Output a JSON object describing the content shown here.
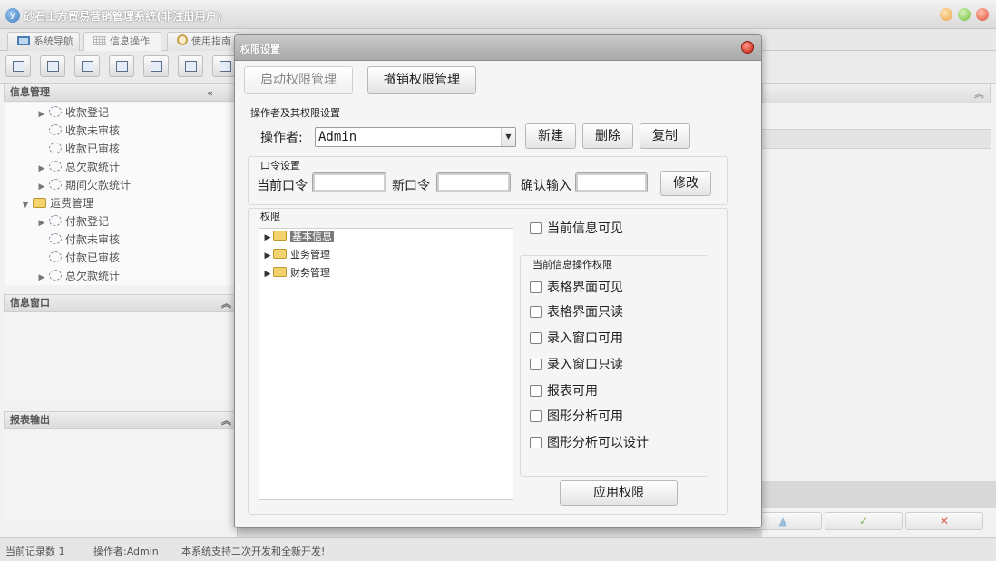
{
  "app": {
    "title": "砂石土方贸易营销管理系统(非注册用户)"
  },
  "tabs": [
    {
      "label": "系统导航"
    },
    {
      "label": "信息操作"
    },
    {
      "label": "使用指南"
    }
  ],
  "left_panel": {
    "info_mgmt_title": "信息管理",
    "collapse_icon": "«",
    "tree": [
      {
        "label": "收款登记",
        "arrow": "▶"
      },
      {
        "label": "收款未审核",
        "arrow": ""
      },
      {
        "label": "收款已审核",
        "arrow": ""
      },
      {
        "label": "总欠款统计",
        "arrow": "▶"
      },
      {
        "label": "期间欠款统计",
        "arrow": "▶"
      },
      {
        "label": "运费管理",
        "arrow": "▼"
      },
      {
        "label": "付款登记",
        "arrow": "▶"
      },
      {
        "label": "付款未审核",
        "arrow": ""
      },
      {
        "label": "付款已审核",
        "arrow": ""
      },
      {
        "label": "总欠款统计",
        "arrow": "▶"
      }
    ],
    "info_window_title": "信息窗口",
    "report_title": "报表输出"
  },
  "statusbar": {
    "record_count": "当前记录数 1",
    "operator": "操作者:Admin",
    "notice": "本系统支持二次开发和全新开发!"
  },
  "dialog": {
    "title": "权限设置",
    "enable_btn": "启动权限管理",
    "revoke_btn": "撤销权限管理",
    "operator_group_label": "操作者及其权限设置",
    "operator_label": "操作者:",
    "operator_value": "Admin",
    "new_btn": "新建",
    "delete_btn": "删除",
    "copy_btn": "复制",
    "password_group_label": "口令设置",
    "current_pwd_label": "当前口令",
    "new_pwd_label": "新口令",
    "confirm_label": "确认输入",
    "modify_btn": "修改",
    "permission_group_label": "权限",
    "perm_tree": [
      {
        "label": "基本信息",
        "selected": true
      },
      {
        "label": "业务管理",
        "selected": false
      },
      {
        "label": "财务管理",
        "selected": false
      }
    ],
    "visible_check": "当前信息可见",
    "ops_group_label": "当前信息操作权限",
    "ops_checks": [
      "表格界面可见",
      "表格界面只读",
      "录入窗口可用",
      "录入窗口只读",
      "报表可用",
      "图形分析可用",
      "图形分析可以设计"
    ],
    "apply_btn": "应用权限"
  },
  "nav_icons": {
    "up": "▲",
    "check": "✓",
    "cross": "✕"
  }
}
